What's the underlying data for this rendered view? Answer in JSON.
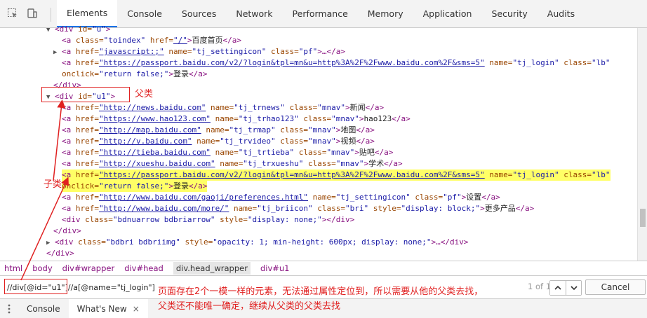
{
  "toolbar": {
    "icons": [
      "inspect-cursor-icon",
      "device-toggle-icon"
    ],
    "tabs": [
      "Elements",
      "Console",
      "Sources",
      "Network",
      "Performance",
      "Memory",
      "Application",
      "Security",
      "Audits"
    ],
    "active_tab": "Elements"
  },
  "dom": {
    "l1": {
      "open": "<div",
      "attr": " id=",
      "val": "\"u\"",
      "close": ">"
    },
    "l2": {
      "pre": "<a",
      "a1": " class=",
      "v1": "\"toindex\"",
      "a2": " href=",
      "v2": "\"/\"",
      "end": ">",
      "text": "百度首页",
      "close": "</a>"
    },
    "l3": {
      "pre": "<a",
      "a1": " href=",
      "v1": "\"javascript:;\"",
      "a2": " name=",
      "v2": "\"tj_settingicon\"",
      "a3": " class=",
      "v3": "\"pf\"",
      "end": ">…</a>"
    },
    "l4": {
      "pre": "<a",
      "a1": " href=",
      "v1": "\"https://passport.baidu.com/v2/?login&tpl=mn&u=http%3A%2F%2Fwww.baidu.com%2F&sms=5\"",
      "a2": " name=",
      "v2": "\"tj_login\"",
      "a3": " class=",
      "v3": "\"lb\""
    },
    "l5": {
      "a1": "onclick=",
      "v1": "\"return false;\"",
      "end": ">",
      "text": "登录",
      "close": "</a>"
    },
    "l6": {
      "close": "</div>"
    },
    "l7": {
      "open": "<div",
      "attr": " id=",
      "val": "\"u1\"",
      "close": ">"
    },
    "l8": {
      "pre": "<a",
      "a1": " href=",
      "v1": "\"http://news.baidu.com\"",
      "a2": " name=",
      "v2": "\"tj_trnews\"",
      "a3": " class=",
      "v3": "\"mnav\"",
      "end": ">",
      "text": "新闻",
      "close": "</a>"
    },
    "l9": {
      "pre": "<a",
      "a1": " href=",
      "v1": "\"https://www.hao123.com\"",
      "a2": " name=",
      "v2": "\"tj_trhao123\"",
      "a3": " class=",
      "v3": "\"mnav\"",
      "end": ">",
      "text": "hao123",
      "close": "</a>"
    },
    "l10": {
      "pre": "<a",
      "a1": " href=",
      "v1": "\"http://map.baidu.com\"",
      "a2": " name=",
      "v2": "\"tj_trmap\"",
      "a3": " class=",
      "v3": "\"mnav\"",
      "end": ">",
      "text": "地图",
      "close": "</a>"
    },
    "l11": {
      "pre": "<a",
      "a1": " href=",
      "v1": "\"http://v.baidu.com\"",
      "a2": " name=",
      "v2": "\"tj_trvideo\"",
      "a3": " class=",
      "v3": "\"mnav\"",
      "end": ">",
      "text": "视频",
      "close": "</a>"
    },
    "l12": {
      "pre": "<a",
      "a1": " href=",
      "v1": "\"http://tieba.baidu.com\"",
      "a2": " name=",
      "v2": "\"tj_trtieba\"",
      "a3": " class=",
      "v3": "\"mnav\"",
      "end": ">",
      "text": "贴吧",
      "close": "</a>"
    },
    "l13": {
      "pre": "<a",
      "a1": " href=",
      "v1": "\"http://xueshu.baidu.com\"",
      "a2": " name=",
      "v2": "\"tj_trxueshu\"",
      "a3": " class=",
      "v3": "\"mnav\"",
      "end": ">",
      "text": "学术",
      "close": "</a>"
    },
    "l14": {
      "pre": "<a",
      "a1": " href=",
      "v1": "\"https://passport.baidu.com/v2/?login&tpl=mn&u=http%3A%2F%2Fwww.baidu.com%2F&sms=5\"",
      "a2": " name=",
      "v2": "\"tj_login\"",
      "a3": " class=",
      "v3": "\"lb\""
    },
    "l15": {
      "a1": "onclick=",
      "v1": "\"return false;\"",
      "end": ">",
      "text": "登录",
      "close": "</a>"
    },
    "l16": {
      "pre": "<a",
      "a1": " href=",
      "v1": "\"http://www.baidu.com/gaoji/preferences.html\"",
      "a2": " name=",
      "v2": "\"tj_settingicon\"",
      "a3": " class=",
      "v3": "\"pf\"",
      "end": ">",
      "text": "设置",
      "close": "</a>"
    },
    "l17": {
      "pre": "<a",
      "a1": " href=",
      "v1": "\"http://www.baidu.com/more/\"",
      "a2": " name=",
      "v2": "\"tj_briicon\"",
      "a3": " class=",
      "v3": "\"bri\"",
      "a4": " style=",
      "v4": "\"display: block;\"",
      "end": ">",
      "text": "更多产品",
      "close": "</a>"
    },
    "l18": {
      "pre": "<div",
      "a1": " class=",
      "v1": "\"bdnuarrow bdbriarrow\"",
      "a2": " style=",
      "v2": "\"display: none;\"",
      "end": "></div>"
    },
    "l19": {
      "close": "</div>"
    },
    "l20": {
      "pre": "<div",
      "a1": " class=",
      "v1": "\"bdbri bdbriimg\"",
      "a2": " style=",
      "v2": "\"opacity: 1; min-height: 600px; display: none;\"",
      "end": ">…</div>"
    },
    "l21": {
      "close": "</div>"
    }
  },
  "breadcrumb": [
    "html",
    "body",
    "div#wrapper",
    "div#head",
    "div.head_wrapper",
    "div#u1"
  ],
  "breadcrumb_active": "div.head_wrapper",
  "search": {
    "value": "//div[@id=\"u1\"]//a[@name=\"tj_login\"]",
    "match_count": "1 of 1",
    "cancel_label": "Cancel"
  },
  "drawer": {
    "tabs": [
      "Console",
      "What's New"
    ],
    "active": "What's New",
    "close_glyph": "×"
  },
  "annotations": {
    "parent": "父类",
    "child": "子类",
    "note_line1": "页面存在2个一模一样的元素，无法通过属性定位到，所以需要从他的父类去找，",
    "note_line2": "父类还不能唯一确定，继续从父类的父类去找"
  },
  "colors": {
    "annotation": "#e02020",
    "highlight": "#ffff66",
    "tag": "#881280",
    "attr": "#994500",
    "value": "#1a1aa6"
  }
}
